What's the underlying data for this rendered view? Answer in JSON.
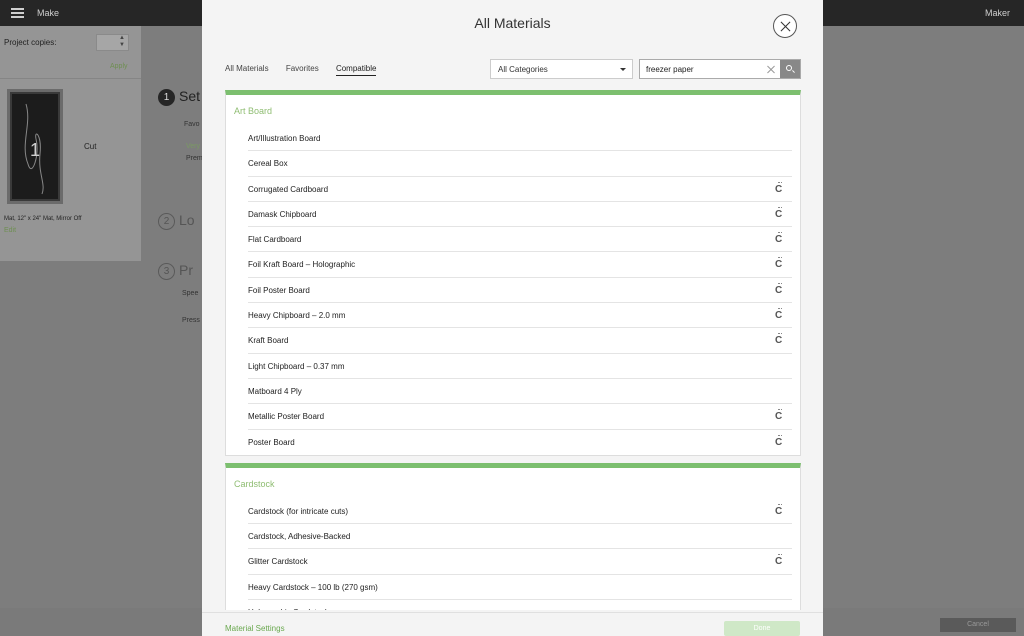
{
  "app": {
    "title": "Make",
    "machine": "Maker"
  },
  "left_panel": {
    "project_copies_label": "Project copies:",
    "apply_label": "Apply",
    "mat_number": "1",
    "cut_label": "Cut",
    "mat_caption": "Mat, 12\" x 24\" Mat, Mirror Off",
    "edit_label": "Edit"
  },
  "background_steps": [
    {
      "num": "1",
      "label": "Set"
    },
    {
      "num": "2",
      "label": "Lo"
    },
    {
      "num": "3",
      "label": "Pr"
    }
  ],
  "background_snippets": {
    "favo": "Favo",
    "very": "Very",
    "prem": "Prem",
    "spee": "Spee",
    "pres": "Press"
  },
  "background_cancel": "Cancel",
  "modal": {
    "title": "All Materials",
    "tabs": [
      {
        "label": "All Materials",
        "active": false
      },
      {
        "label": "Favorites",
        "active": false
      },
      {
        "label": "Compatible",
        "active": true
      }
    ],
    "category_select": {
      "value": "All Categories"
    },
    "search": {
      "value": "freezer paper",
      "placeholder": ""
    },
    "groups": [
      {
        "title": "Art Board",
        "items": [
          {
            "label": "Art/Illustration Board",
            "compatible_icon": false
          },
          {
            "label": "Cereal Box",
            "compatible_icon": false
          },
          {
            "label": "Corrugated Cardboard",
            "compatible_icon": true
          },
          {
            "label": "Damask Chipboard",
            "compatible_icon": true
          },
          {
            "label": "Flat Cardboard",
            "compatible_icon": true
          },
          {
            "label": "Foil Kraft Board  – Holographic",
            "compatible_icon": true
          },
          {
            "label": "Foil Poster Board",
            "compatible_icon": true
          },
          {
            "label": "Heavy Chipboard – 2.0 mm",
            "compatible_icon": true
          },
          {
            "label": "Kraft Board",
            "compatible_icon": true
          },
          {
            "label": "Light Chipboard – 0.37 mm",
            "compatible_icon": false
          },
          {
            "label": "Matboard 4 Ply",
            "compatible_icon": false
          },
          {
            "label": "Metallic Poster Board",
            "compatible_icon": true
          },
          {
            "label": "Poster Board",
            "compatible_icon": true
          }
        ]
      },
      {
        "title": "Cardstock",
        "items": [
          {
            "label": "Cardstock (for intricate cuts)",
            "compatible_icon": true
          },
          {
            "label": "Cardstock, Adhesive-Backed",
            "compatible_icon": false
          },
          {
            "label": "Glitter Cardstock",
            "compatible_icon": true
          },
          {
            "label": "Heavy Cardstock – 100 lb (270 gsm)",
            "compatible_icon": false
          },
          {
            "label": "Holographic Cardstock",
            "compatible_icon": false
          }
        ]
      }
    ],
    "footer": {
      "settings_link": "Material Settings",
      "done_label": "Done"
    }
  },
  "colors": {
    "accent_green": "#7cbf6f",
    "group_title_green": "#8fbd72",
    "link_green": "#6aa84f",
    "topbar": "#262626"
  },
  "icons": {
    "menu": "hamburger-icon",
    "close": "close-icon",
    "clear": "clear-icon",
    "search": "search-icon",
    "compatible": "cricut-c-icon",
    "dropdown": "chevron-down-icon"
  }
}
